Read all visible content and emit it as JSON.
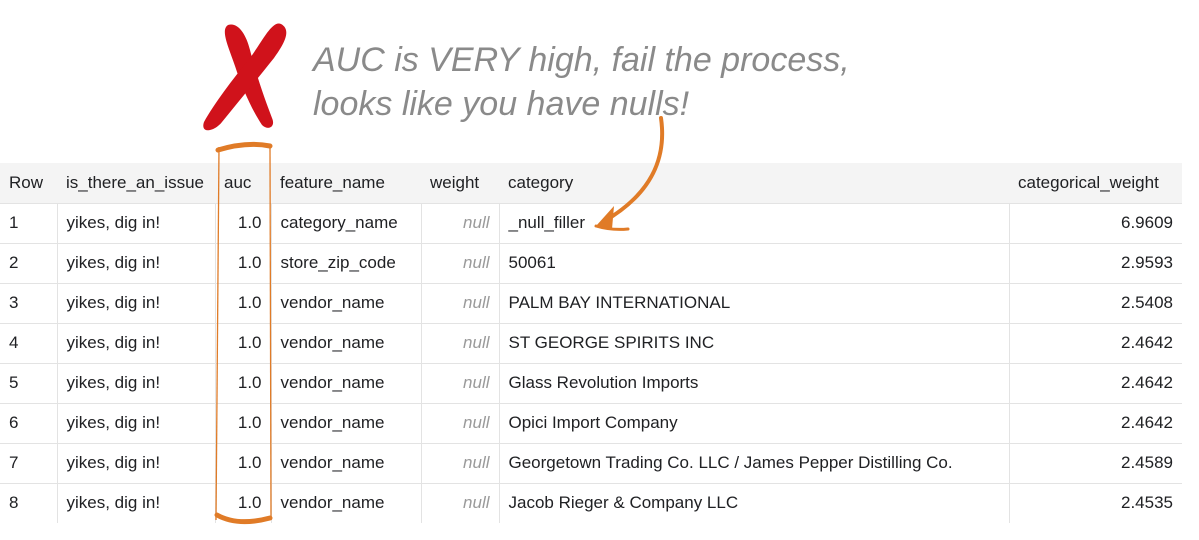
{
  "annotation": {
    "line1": "AUC is VERY high, fail the process,",
    "line2": "looks like you have nulls!"
  },
  "colors": {
    "red_x": "#d0121b",
    "orange_accent": "#e07b27",
    "annotation_text": "#8a8a8a",
    "header_bg": "#f4f4f4"
  },
  "table": {
    "columns": [
      "Row",
      "is_there_an_issue",
      "auc",
      "feature_name",
      "weight",
      "category",
      "categorical_weight"
    ],
    "rows": [
      [
        "1",
        "yikes, dig in!",
        "1.0",
        "category_name",
        "null",
        "_null_filler",
        "6.9609"
      ],
      [
        "2",
        "yikes, dig in!",
        "1.0",
        "store_zip_code",
        "null",
        "50061",
        "2.9593"
      ],
      [
        "3",
        "yikes, dig in!",
        "1.0",
        "vendor_name",
        "null",
        "PALM BAY INTERNATIONAL",
        "2.5408"
      ],
      [
        "4",
        "yikes, dig in!",
        "1.0",
        "vendor_name",
        "null",
        "ST GEORGE SPIRITS INC",
        "2.4642"
      ],
      [
        "5",
        "yikes, dig in!",
        "1.0",
        "vendor_name",
        "null",
        "Glass Revolution Imports",
        "2.4642"
      ],
      [
        "6",
        "yikes, dig in!",
        "1.0",
        "vendor_name",
        "null",
        "Opici Import Company",
        "2.4642"
      ],
      [
        "7",
        "yikes, dig in!",
        "1.0",
        "vendor_name",
        "null",
        "Georgetown Trading Co. LLC / James Pepper Distilling Co.",
        "2.4589"
      ],
      [
        "8",
        "yikes, dig in!",
        "1.0",
        "vendor_name",
        "null",
        "Jacob Rieger & Company LLC",
        "2.4535"
      ]
    ]
  }
}
